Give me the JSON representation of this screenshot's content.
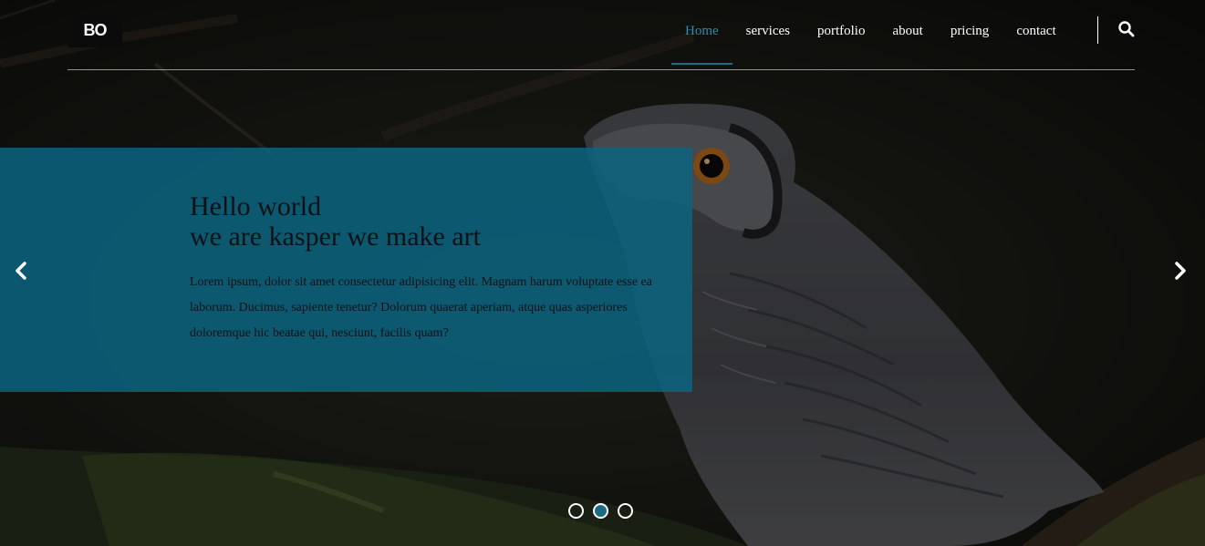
{
  "header": {
    "logo_text": "BO",
    "nav": [
      {
        "label": "Home",
        "active": true
      },
      {
        "label": "services",
        "active": false
      },
      {
        "label": "portfolio",
        "active": false
      },
      {
        "label": "about",
        "active": false
      },
      {
        "label": "pricing",
        "active": false
      },
      {
        "label": "contact",
        "active": false
      }
    ],
    "search_icon": "search-icon"
  },
  "hero": {
    "title_line1": "Hello world",
    "title_line2": "we are kasper we make art",
    "body": "Lorem ipsum, dolor sit amet consectetur adipisicing elit. Magnam harum voluptate esse ea laborum. Ducimus, sapiente tenetur? Dolorum quaerat aperiam, atque quas asperiores doloremque hic beatae qui, nesciunt, facilis quam?"
  },
  "slider": {
    "prev_icon": "chevron-left-icon",
    "next_icon": "chevron-right-icon",
    "dots_total": 3,
    "active_dot": 2
  },
  "colors": {
    "accent": "#1b6c82",
    "active_link": "#2a8fa9",
    "panel": "#0b6582",
    "text_dark": "#0c1116"
  }
}
